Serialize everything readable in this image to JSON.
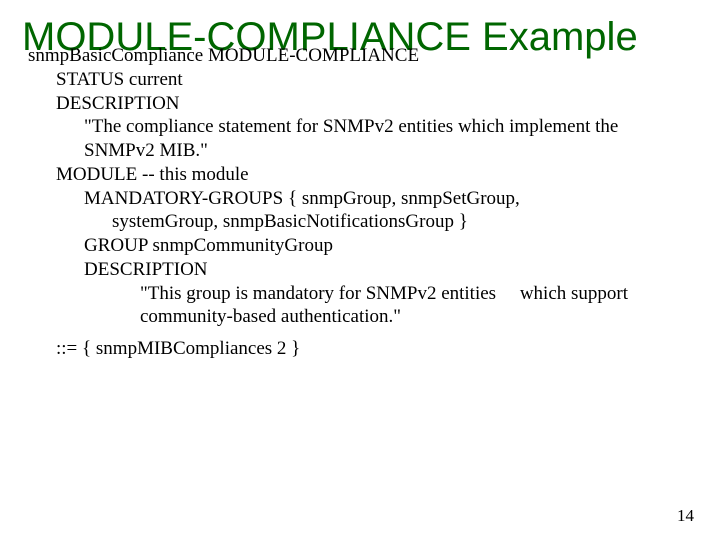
{
  "title": "MODULE-COMPLIANCE Example",
  "body": {
    "l01": "snmpBasicCompliance MODULE-COMPLIANCE",
    "l02": "STATUS current",
    "l03": "DESCRIPTION",
    "l04": "\"The compliance statement for SNMPv2 entities which implement the",
    "l05": "SNMPv2 MIB.\"",
    "l06": "MODULE -- this module",
    "l07": "MANDATORY-GROUPS { snmpGroup, snmpSetGroup,",
    "l08": "systemGroup, snmpBasicNotificationsGroup }",
    "l09": "GROUP snmpCommunityGroup",
    "l10": "DESCRIPTION",
    "l11": "\"This group is mandatory for SNMPv2 entities     which support",
    "l12": "community-based authentication.\"",
    "l13": "::= { snmpMIBCompliances 2 }"
  },
  "pagenum": "14"
}
